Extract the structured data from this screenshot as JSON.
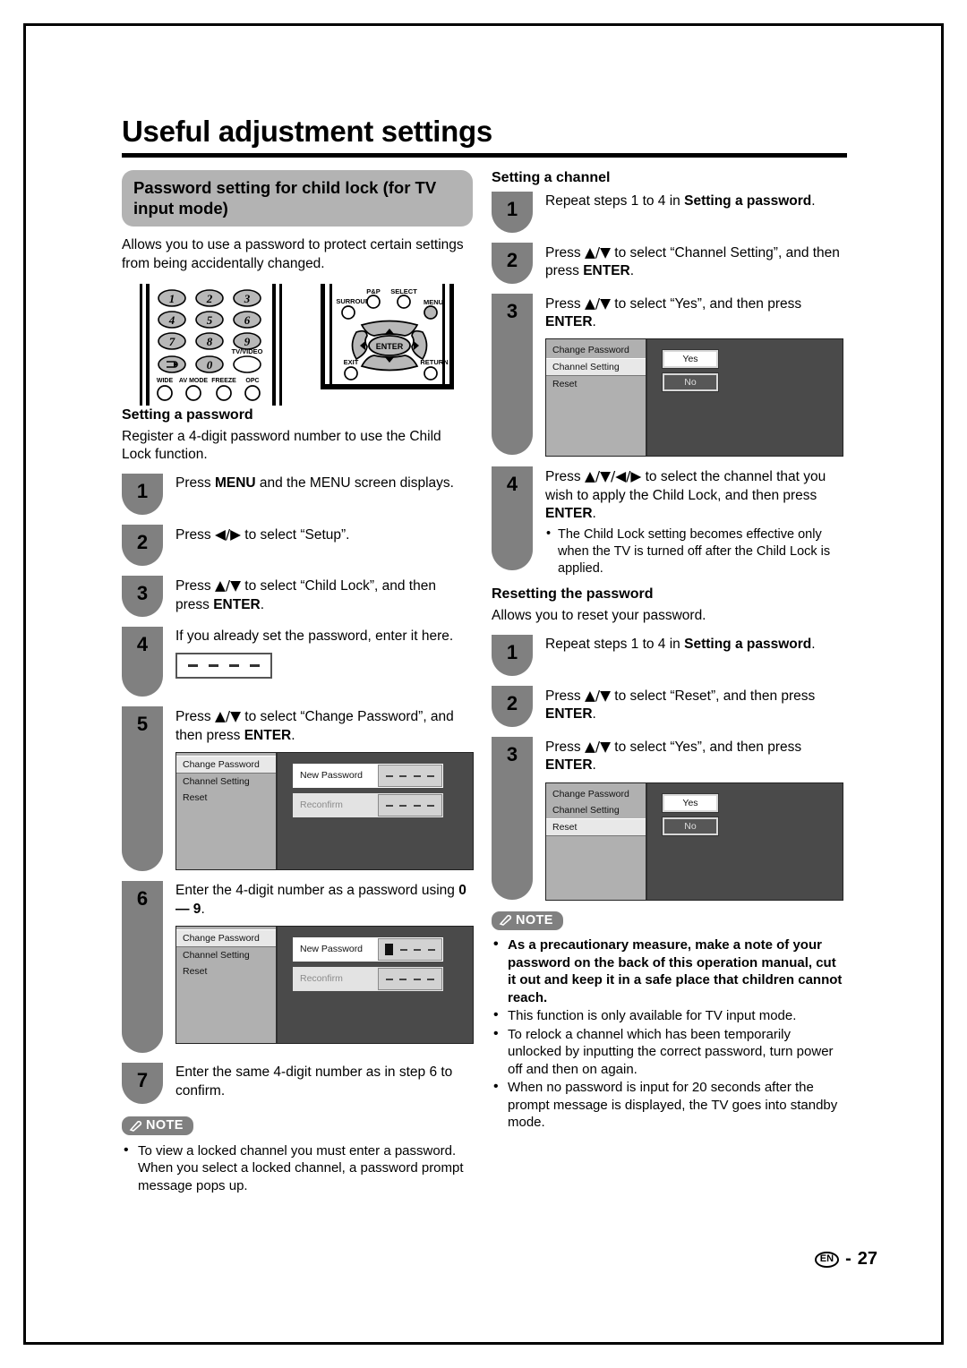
{
  "page": {
    "title": "Useful adjustment settings",
    "footer_lang": "EN",
    "footer_dash": "-",
    "footer_page": "27"
  },
  "left": {
    "banner": "Password setting for child lock (for TV input mode)",
    "intro": "Allows you to use a password to protect certain settings from being accidentally changed.",
    "remote": {
      "numpad": [
        "1",
        "2",
        "3",
        "4",
        "5",
        "6",
        "7",
        "8",
        "9",
        "0"
      ],
      "flashback_label": "flashback-icon",
      "tv_video_label": "TV/VIDEO",
      "bottom_row": [
        "WIDE",
        "AV MODE",
        "FREEZE",
        "OPC"
      ],
      "nav_labels": {
        "surround": "SURROUND",
        "pp": "P&P",
        "select": "SELECT",
        "menu": "MENU",
        "exit": "EXIT",
        "return": "RETURN",
        "enter": "ENTER"
      }
    },
    "section_title": "Setting a password",
    "section_intro": "Register a 4-digit password number to use the Child Lock function.",
    "steps": [
      {
        "n": "1",
        "text": "Press MENU and the MENU screen displays."
      },
      {
        "n": "2",
        "text": "Press ◀/▶ to select “Setup”."
      },
      {
        "n": "3",
        "text": "Press ▲/▼ to select “Child Lock”, and then press ENTER."
      },
      {
        "n": "4",
        "text": "If you already set the password, enter it here."
      },
      {
        "n": "5",
        "text": "Press ▲/▼ to select “Change Password”, and then press ENTER."
      },
      {
        "n": "6",
        "text": "Enter the 4-digit number as a password using 0 — 9."
      },
      {
        "n": "7",
        "text": "Enter the same 4-digit number as in step 6 to confirm."
      }
    ],
    "osd_menu_items": [
      "Change Password",
      "Channel Setting",
      "Reset"
    ],
    "osd_fields": {
      "new_password": "New Password",
      "reconfirm": "Reconfirm"
    },
    "note": {
      "label": "NOTE",
      "items": [
        "To view a locked channel you must enter a password. When you select a locked channel, a password prompt message pops up."
      ]
    }
  },
  "right": {
    "channel_section_title": "Setting a channel",
    "channel_steps": [
      {
        "n": "1",
        "text": "Repeat steps 1 to 4 in Setting a password."
      },
      {
        "n": "2",
        "text": "Press ▲/▼ to select “Channel Setting”, and then press ENTER."
      },
      {
        "n": "3",
        "text": "Press ▲/▼ to select “Yes”, and then press ENTER."
      },
      {
        "n": "4",
        "text": "Press ▲/▼/◀/▶ to select the channel that you wish to apply the Child Lock, and then press ENTER."
      }
    ],
    "step4_bullets": [
      "The Child Lock setting becomes effective only when the TV is turned off after the Child Lock is applied."
    ],
    "reset_section_title": "Resetting the password",
    "reset_intro": "Allows you to reset your password.",
    "reset_steps": [
      {
        "n": "1",
        "text": "Repeat steps 1 to 4 in Setting a password."
      },
      {
        "n": "2",
        "text": "Press ▲/▼ to select “Reset”, and then press ENTER."
      },
      {
        "n": "3",
        "text": "Press ▲/▼ to select “Yes”, and then press ENTER."
      }
    ],
    "osd_menu_items": [
      "Change Password",
      "Channel Setting",
      "Reset"
    ],
    "osd_buttons": {
      "yes": "Yes",
      "no": "No"
    },
    "note": {
      "label": "NOTE",
      "items": [
        "As a precautionary measure, make a note of your password on the back of this operation manual, cut it out and keep it in a safe place that children cannot reach.",
        "This function is only available for TV input mode.",
        "To relock a channel which has been temporarily unlocked by inputting the correct password, turn power off and then on again.",
        "When no password is input for 20 seconds after the prompt message is displayed, the TV goes into standby mode."
      ]
    }
  }
}
